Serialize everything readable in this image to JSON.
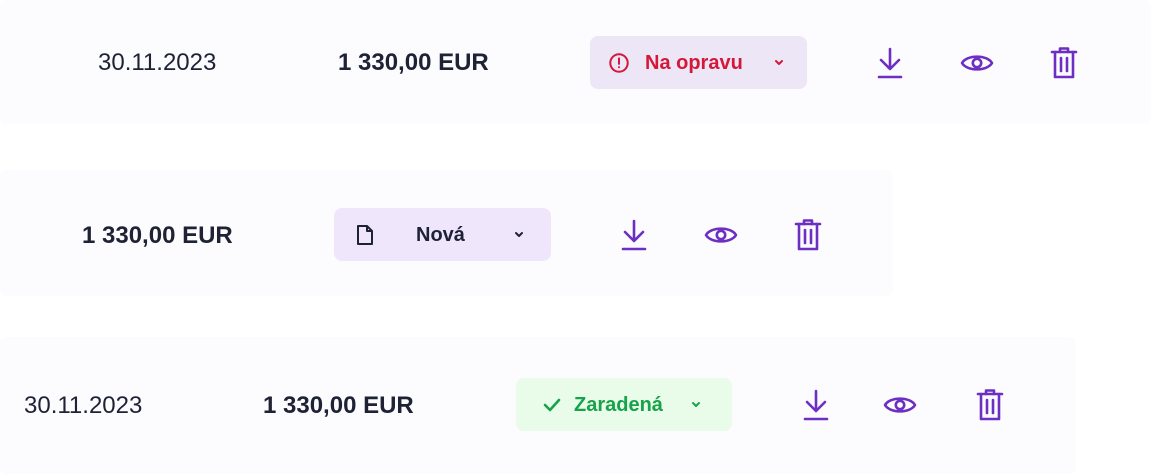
{
  "colors": {
    "accent": "#6d2fc2",
    "text": "#1e2235",
    "row_bg": "#fcfbfe",
    "status_fix_bg": "#ede6f7",
    "status_fix_text": "#d4183a",
    "status_new_bg": "#efe6fc",
    "status_new_text": "#1e2235",
    "status_done_bg": "#e9fbe9",
    "status_done_text": "#17a34a"
  },
  "rows": [
    {
      "date": "30.11.2023",
      "amount": "1 330,00 EUR",
      "status": {
        "label": "Na opravu",
        "icon": "alert-circle-icon"
      },
      "actions": [
        "download-icon",
        "eye-icon",
        "trash-icon"
      ]
    },
    {
      "amount": "1 330,00 EUR",
      "status": {
        "label": "Nová",
        "icon": "document-icon"
      },
      "actions": [
        "download-icon",
        "eye-icon",
        "trash-icon"
      ]
    },
    {
      "date": "30.11.2023",
      "amount": "1 330,00 EUR",
      "status": {
        "label": "Zaradená",
        "icon": "check-icon"
      },
      "actions": [
        "download-icon",
        "eye-icon",
        "trash-icon"
      ]
    }
  ]
}
